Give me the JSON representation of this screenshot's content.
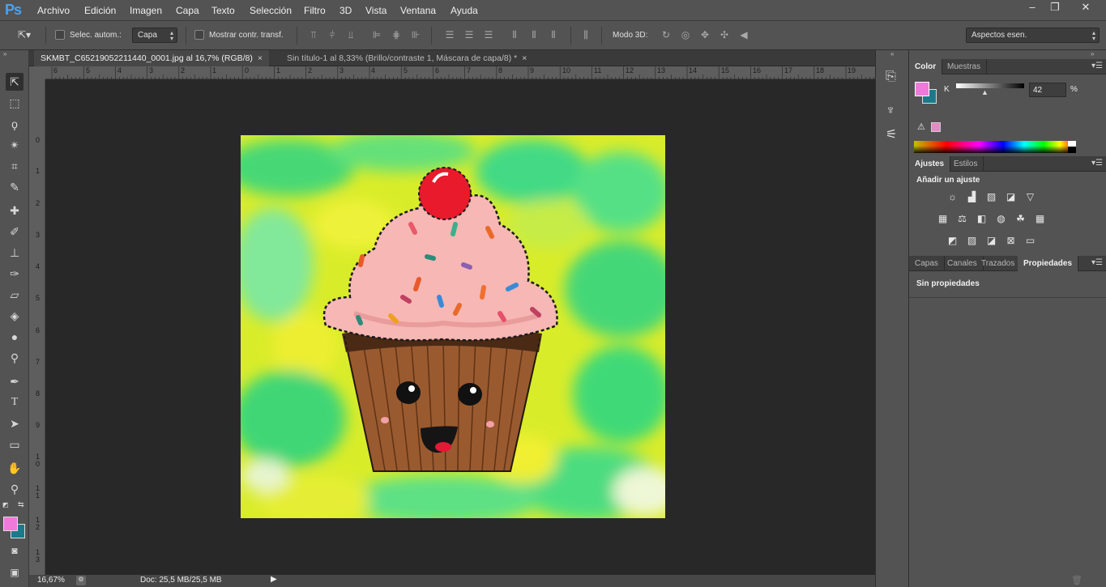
{
  "app": {
    "logo": "Ps"
  },
  "menubar": {
    "items": [
      "Archivo",
      "Edición",
      "Imagen",
      "Capa",
      "Texto",
      "Selección",
      "Filtro",
      "3D",
      "Vista",
      "Ventana",
      "Ayuda"
    ],
    "window_controls": {
      "minimize": "–",
      "restore": "❐",
      "close": "✕"
    }
  },
  "options_bar": {
    "auto_select_label": "Selec. autom.:",
    "auto_select_value": "Capa",
    "show_transform_label": "Mostrar contr. transf.",
    "mode3d_label": "Modo 3D:",
    "workspace_value": "Aspectos esen."
  },
  "tabs": [
    {
      "label": "SKMBT_C65219052211440_0001.jpg al 16,7% (RGB/8)",
      "close": "×"
    },
    {
      "label": "Sin título-1 al 8,33% (Brillo/contraste 1, Máscara de capa/8) *",
      "close": "×"
    }
  ],
  "rulers": {
    "h": [
      "6",
      "5",
      "4",
      "3",
      "2",
      "1",
      "0",
      "1",
      "2",
      "3",
      "4",
      "5",
      "6",
      "7",
      "8",
      "9",
      "10",
      "11",
      "12",
      "13",
      "14",
      "15",
      "16",
      "17",
      "18",
      "19"
    ],
    "v": [
      "0",
      "1",
      "2",
      "3",
      "4",
      "5",
      "6",
      "7",
      "8",
      "9",
      "1\n0",
      "1\n1",
      "1\n2",
      "1\n3"
    ]
  },
  "status": {
    "zoom": "16,67%",
    "doc": "Doc: 25,5 MB/25,5 MB"
  },
  "color_panel": {
    "tabs": [
      "Color",
      "Muestras"
    ],
    "channel_label": "K",
    "value": "42",
    "unit": "%",
    "foreground": "#f07ad9",
    "background": "#1a7a8a",
    "warning_swatch": "#e58ac6"
  },
  "adjust_panel": {
    "tabs": [
      "Ajustes",
      "Estilos"
    ],
    "heading": "Añadir un ajuste"
  },
  "props_panel": {
    "tabs": [
      "Capas",
      "Canales",
      "Trazados",
      "Propiedades"
    ],
    "text": "Sin propiedades"
  }
}
